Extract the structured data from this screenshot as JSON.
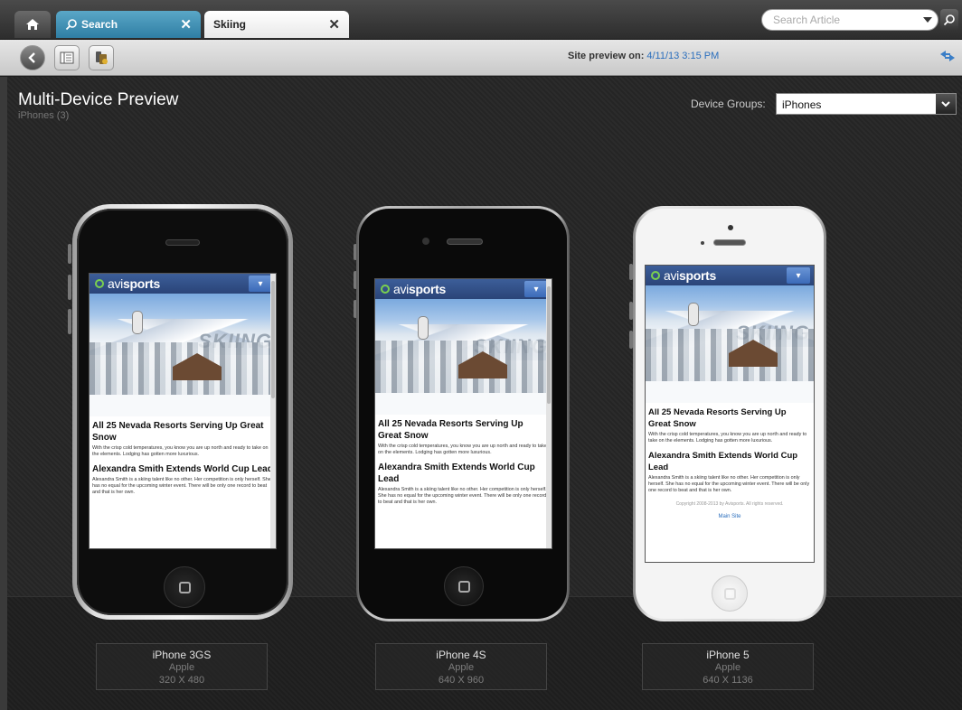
{
  "tabs": {
    "search_label": "Search",
    "skiing_label": "Skiing"
  },
  "search": {
    "placeholder": "Search Article"
  },
  "toolbar": {
    "site_preview_label": "Site preview on:",
    "site_preview_date": "4/11/13 3:15 PM"
  },
  "page": {
    "title": "Multi-Device Preview",
    "subtitle": "iPhones (3)",
    "device_groups_label": "Device Groups:",
    "device_groups_value": "iPhones"
  },
  "site": {
    "logo_prefix": "avi",
    "logo_suffix": "sports",
    "hero_word": "SKIING",
    "article1_title": "All 25 Nevada Resorts Serving Up Great Snow",
    "article1_text": "With the crisp cold temperatures, you know you are up north and ready to take on the elements. Lodging has gotten more luxurious.",
    "article2_title": "Alexandra Smith Extends World Cup Lead",
    "article2_text": "Alexandra Smith is a skiing talent like no other. Her competition is only herself. She has no equal for the upcoming winter event. There will be only one record to beat and that is her own.",
    "footer": "Copyright 2008-2013 by Avisports. All rights reserved.",
    "main_site": "Main Site"
  },
  "devices": [
    {
      "name": "iPhone 3GS",
      "maker": "Apple",
      "resolution": "320 X 480"
    },
    {
      "name": "iPhone 4S",
      "maker": "Apple",
      "resolution": "640 X 960"
    },
    {
      "name": "iPhone 5",
      "maker": "Apple",
      "resolution": "640 X 1136"
    }
  ],
  "colors": {
    "accent_tab": "#2f7ea4",
    "link": "#2a6ebd",
    "site_header": "#2a4478"
  }
}
